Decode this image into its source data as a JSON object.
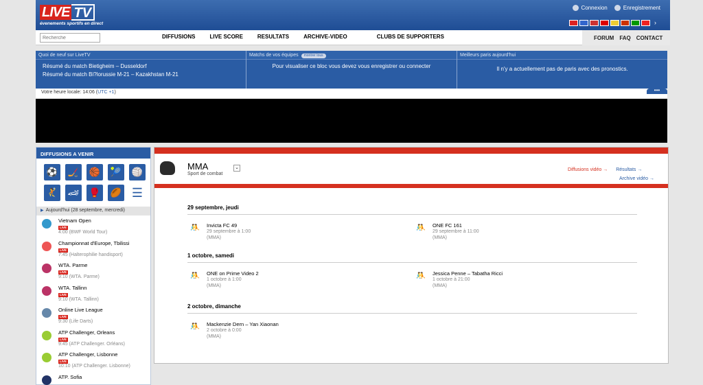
{
  "header": {
    "logo_live": "LIVE",
    "logo_tv": "TV",
    "tagline": "évenements sportifs en direct",
    "login": "Connexion",
    "register": "Enregistrement",
    "flags": [
      "#d22",
      "#36c",
      "#c33",
      "#d00",
      "#ec3",
      "#c30",
      "#090",
      "#e22"
    ]
  },
  "nav": {
    "search_placeholder": "Recherche",
    "items": [
      "DIFFUSIONS",
      "LIVE SCORE",
      "RESULTATS",
      "ARCHIVE-VIDEO",
      "CLUBS DE SUPPORTERS"
    ],
    "right": [
      "FORUM",
      "FAQ",
      "CONTACT"
    ]
  },
  "info": {
    "news_title": "Quoi de neuf sur LiveTV",
    "news": [
      "Résumé du match Bietigheim – Dusseldorf",
      "Résumé du match Bi?lorussie M-21 – Kazakhstan M-21"
    ],
    "teams_title": "Matchs de vos équipes",
    "teams_badge": "montrer tous",
    "teams_text": "Pour visualiser ce bloc vous devez vous enregistrer ou connecter",
    "bets_title": "Meilleurs paris aujourd'hui",
    "bets_text": "Il n'y a actuellement pas de paris avec des pronostics."
  },
  "time": {
    "label": "Votre heure locale: 14:06 (",
    "tz": "UTC +1",
    ")": ")"
  },
  "sidebar": {
    "title": "DIFFUSIONS A VENIR",
    "today": "Aujourd'hui (28 septembre, mercredi)",
    "live_label": "LIVE",
    "events": [
      {
        "name": "Vietnam Open",
        "time": "4:00 (BWF World Tour)",
        "color": "#39c"
      },
      {
        "name": "Championnat d'Europe, Tbilissi",
        "time": "7:45 (Halterophilie handisport)",
        "color": "#e55"
      },
      {
        "name": "WTA. Parme",
        "time": "9:10 (WTA. Parme)",
        "color": "#b36"
      },
      {
        "name": "WTA. Tallinn",
        "time": "9:10 (WTA. Tallinn)",
        "color": "#b36"
      },
      {
        "name": "Online Live League",
        "time": "9:30 (Life Darts)",
        "color": "#68a"
      },
      {
        "name": "ATP Challenger, Orleans",
        "time": "9:45 (ATP Challenger. Orléans)",
        "color": "#9c3"
      },
      {
        "name": "ATP Challenger, Lisbonne",
        "time": "10:10 (ATP Challenger. Lisbonne)",
        "color": "#9c3"
      },
      {
        "name": "ATP. Sofia",
        "time": "",
        "color": "#236"
      }
    ]
  },
  "main": {
    "title": "MMA",
    "subtitle": "Sport de combat",
    "link_video": "Diffusions vidéo →",
    "link_results": "Résultats →",
    "link_archive": "Archive vidéo →",
    "days": [
      {
        "label": "29 septembre, jeudi",
        "games": [
          {
            "name": "Invicta FC 49",
            "date": "29 septembre à 1:00",
            "cat": "(MMA)"
          },
          {
            "name": "ONE FC 161",
            "date": "29 septembre à 11:00",
            "cat": "(MMA)"
          }
        ]
      },
      {
        "label": "1 octobre, samedi",
        "games": [
          {
            "name": "ONE on Prime Video 2",
            "date": "1 octobre à 1:00",
            "cat": "(MMA)"
          },
          {
            "name": "Jessica Penne – Tabatha Ricci",
            "date": "1 octobre à 21:00",
            "cat": "(MMA)"
          }
        ]
      },
      {
        "label": "2 octobre, dimanche",
        "games": [
          {
            "name": "Mackenzie Dern – Yan Xiaonan",
            "date": "2 octobre à 0:00",
            "cat": "(MMA)"
          }
        ]
      }
    ]
  }
}
